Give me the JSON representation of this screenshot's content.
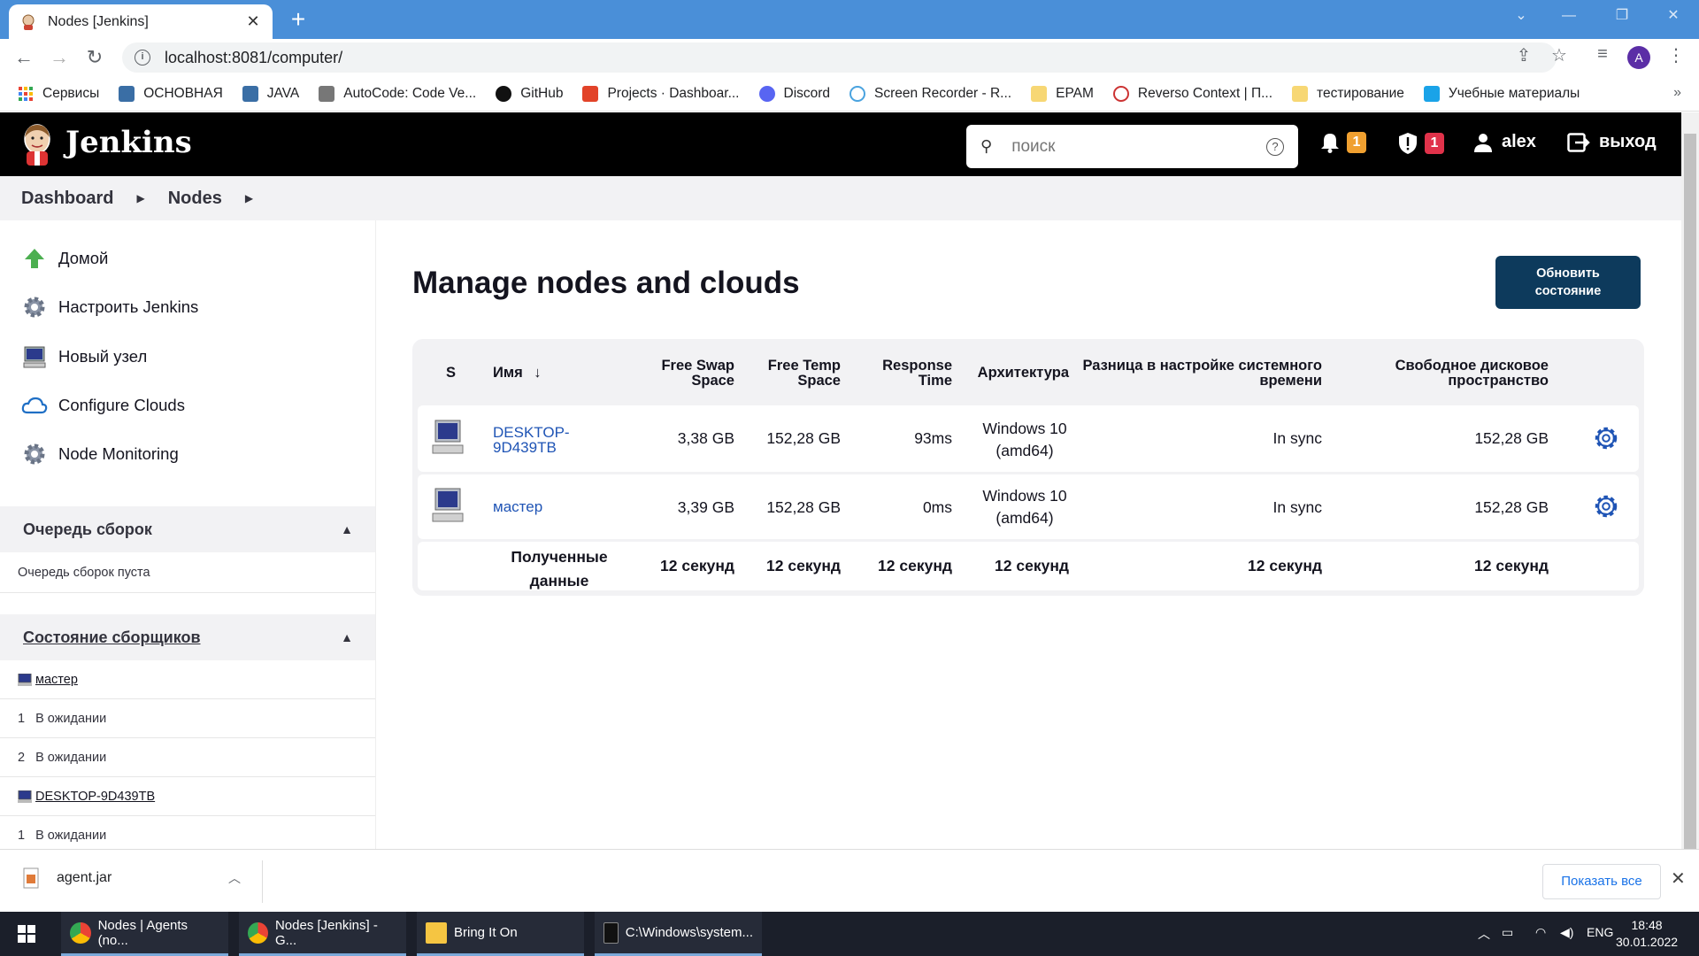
{
  "browser": {
    "tab_title": "Nodes [Jenkins]",
    "url": "localhost:8081/computer/",
    "profile_initial": "A",
    "bookmarks": [
      {
        "label": "Сервисы"
      },
      {
        "label": "ОСНОВНАЯ"
      },
      {
        "label": "JAVA"
      },
      {
        "label": "AutoCode: Code Ve..."
      },
      {
        "label": "GitHub"
      },
      {
        "label": "Projects · Dashboar..."
      },
      {
        "label": "Discord"
      },
      {
        "label": "Screen Recorder - R..."
      },
      {
        "label": "EPAM"
      },
      {
        "label": "Reverso Context | П..."
      },
      {
        "label": "тестирование"
      },
      {
        "label": "Учебные материалы"
      }
    ]
  },
  "jenkins": {
    "brand": "Jenkins",
    "search_placeholder": "поиск",
    "notifications_count": "1",
    "security_count": "1",
    "user": "alex",
    "logout": "выход"
  },
  "breadcrumb": [
    "Dashboard",
    "Nodes"
  ],
  "sidebar": {
    "tasks": [
      {
        "label": "Домой",
        "icon": "home-arrow-icon"
      },
      {
        "label": "Настроить Jenkins",
        "icon": "gear-icon"
      },
      {
        "label": "Новый узел",
        "icon": "computer-icon"
      },
      {
        "label": "Configure Clouds",
        "icon": "cloud-icon"
      },
      {
        "label": "Node Monitoring",
        "icon": "gear-icon"
      }
    ],
    "queue": {
      "title": "Очередь сборок",
      "empty_text": "Очередь сборок пуста"
    },
    "executors": {
      "title": "Состояние сборщиков",
      "nodes": [
        {
          "name": "мастер",
          "executors": [
            {
              "num": "1",
              "status": "В ожидании"
            },
            {
              "num": "2",
              "status": "В ожидании"
            }
          ]
        },
        {
          "name": "DESKTOP-9D439TB",
          "executors": [
            {
              "num": "1",
              "status": "В ожидании"
            }
          ]
        }
      ]
    }
  },
  "main": {
    "title": "Manage nodes and clouds",
    "refresh_button": "Обновить состояние",
    "columns": {
      "s": "S",
      "name": "Имя",
      "sort_arrow": "↓",
      "swap": "Free Swap Space",
      "temp": "Free Temp Space",
      "response": "Response Time",
      "arch": "Архитектура",
      "clock": "Разница в настройке системного времени",
      "disk": "Свободное дисковое пространство"
    },
    "rows": [
      {
        "name": "DESKTOP-9D439TB",
        "swap": "3,38 GB",
        "temp": "152,28 GB",
        "response": "93ms",
        "arch": "Windows 10 (amd64)",
        "clock": "In sync",
        "disk": "152,28 GB"
      },
      {
        "name": "мастер",
        "swap": "3,39 GB",
        "temp": "152,28 GB",
        "response": "0ms",
        "arch": "Windows 10 (amd64)",
        "clock": "In sync",
        "disk": "152,28 GB"
      }
    ],
    "footer": {
      "label": "Полученные данные",
      "swap": "12 секунд",
      "temp": "12 секунд",
      "response": "12 секунд",
      "arch": "12 секунд",
      "clock": "12 секунд",
      "disk": "12 секунд"
    }
  },
  "downloads": {
    "file": "agent.jar",
    "show_all": "Показать все"
  },
  "taskbar": {
    "items": [
      {
        "label": "Nodes | Agents (no..."
      },
      {
        "label": "Nodes [Jenkins] - G..."
      },
      {
        "label": "Bring It On"
      },
      {
        "label": "C:\\Windows\\system..."
      }
    ],
    "language": "ENG",
    "time": "18:48",
    "date": "30.01.2022"
  }
}
